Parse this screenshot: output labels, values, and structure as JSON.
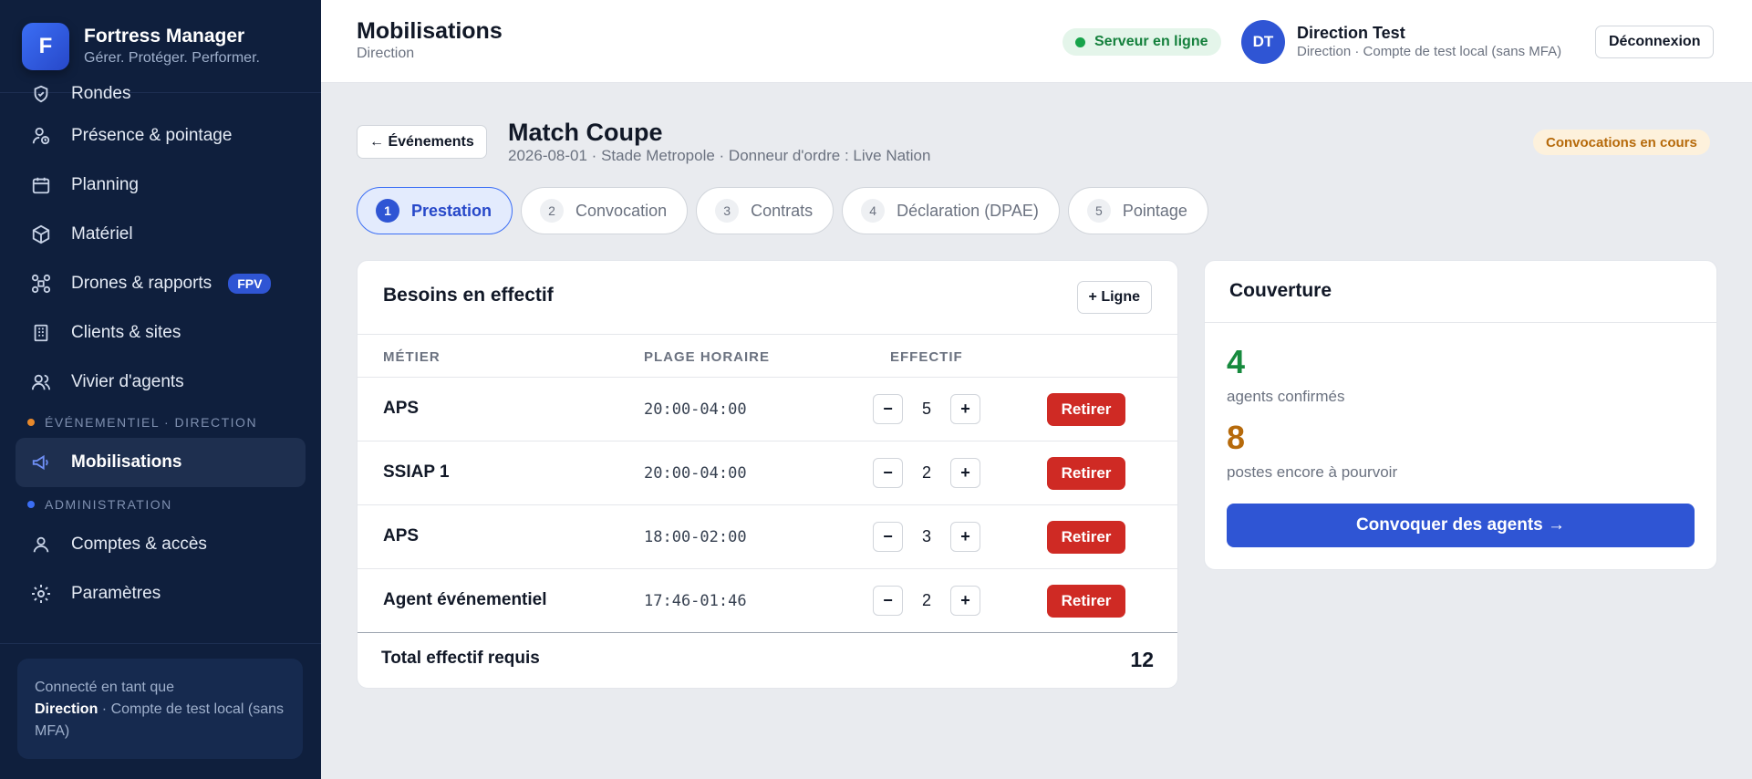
{
  "brand": {
    "logo_letter": "F",
    "name": "Fortress Manager",
    "tagline": "Gérer. Protéger. Performer."
  },
  "sidebar": {
    "items": [
      {
        "label": "Rondes",
        "icon": "shield-check-icon"
      },
      {
        "label": "Présence & pointage",
        "icon": "user-clock-icon"
      },
      {
        "label": "Planning",
        "icon": "calendar-icon"
      },
      {
        "label": "Matériel",
        "icon": "box-icon"
      },
      {
        "label": "Drones & rapports",
        "icon": "drone-icon",
        "badge": "FPV"
      },
      {
        "label": "Clients & sites",
        "icon": "building-icon"
      },
      {
        "label": "Vivier d'agents",
        "icon": "users-icon"
      }
    ],
    "section_event": {
      "label": "ÉVÉNEMENTIEL · DIRECTION",
      "dot_color": "#e8892b"
    },
    "active_item": {
      "label": "Mobilisations",
      "icon": "megaphone-icon"
    },
    "section_admin": {
      "label": "ADMINISTRATION",
      "dot_color": "#3b6ef5"
    },
    "admin_items": [
      {
        "label": "Comptes & accès",
        "icon": "user-icon"
      },
      {
        "label": "Paramètres",
        "icon": "gear-icon"
      }
    ],
    "connected": {
      "prefix": "Connecté en tant que",
      "role": "Direction",
      "suffix": "· Compte de test local (sans MFA)"
    }
  },
  "header": {
    "title": "Mobilisations",
    "subtitle": "Direction",
    "server_status": "Serveur en ligne",
    "user": {
      "initials": "DT",
      "name": "Direction Test",
      "role": "Direction · Compte de test local (sans MFA)"
    },
    "logout_label": "Déconnexion"
  },
  "event": {
    "back_label": "← Événements",
    "title": "Match Coupe",
    "meta": "2026-08-01 · Stade Metropole · Donneur d'ordre : Live Nation",
    "status": "Convocations en cours"
  },
  "steps": [
    {
      "num": "1",
      "label": "Prestation"
    },
    {
      "num": "2",
      "label": "Convocation"
    },
    {
      "num": "3",
      "label": "Contrats"
    },
    {
      "num": "4",
      "label": "Déclaration (DPAE)"
    },
    {
      "num": "5",
      "label": "Pointage"
    }
  ],
  "besoins": {
    "title": "Besoins en effectif",
    "add_label": "+ Ligne",
    "columns": {
      "metier": "MÉTIER",
      "plage": "PLAGE HORAIRE",
      "effectif": "EFFECTIF"
    },
    "rows": [
      {
        "metier": "APS",
        "plage": "20:00-04:00",
        "effectif": "5"
      },
      {
        "metier": "SSIAP 1",
        "plage": "20:00-04:00",
        "effectif": "2"
      },
      {
        "metier": "APS",
        "plage": "18:00-02:00",
        "effectif": "3"
      },
      {
        "metier": "Agent événementiel",
        "plage": "17:46-01:46",
        "effectif": "2"
      }
    ],
    "minus_label": "−",
    "plus_label": "+",
    "remove_label": "Retirer",
    "total_label": "Total effectif requis",
    "total_value": "12"
  },
  "couverture": {
    "title": "Couverture",
    "confirmed_value": "4",
    "confirmed_label": "agents confirmés",
    "open_value": "8",
    "open_label": "postes encore à pourvoir",
    "cta_label": "Convoquer des agents →"
  },
  "colors": {
    "accent": "#2f55d4",
    "danger": "#cf2a24",
    "success": "#178a3e",
    "warning": "#b66a0b",
    "sidebar_bg": "#0f1f3d"
  }
}
